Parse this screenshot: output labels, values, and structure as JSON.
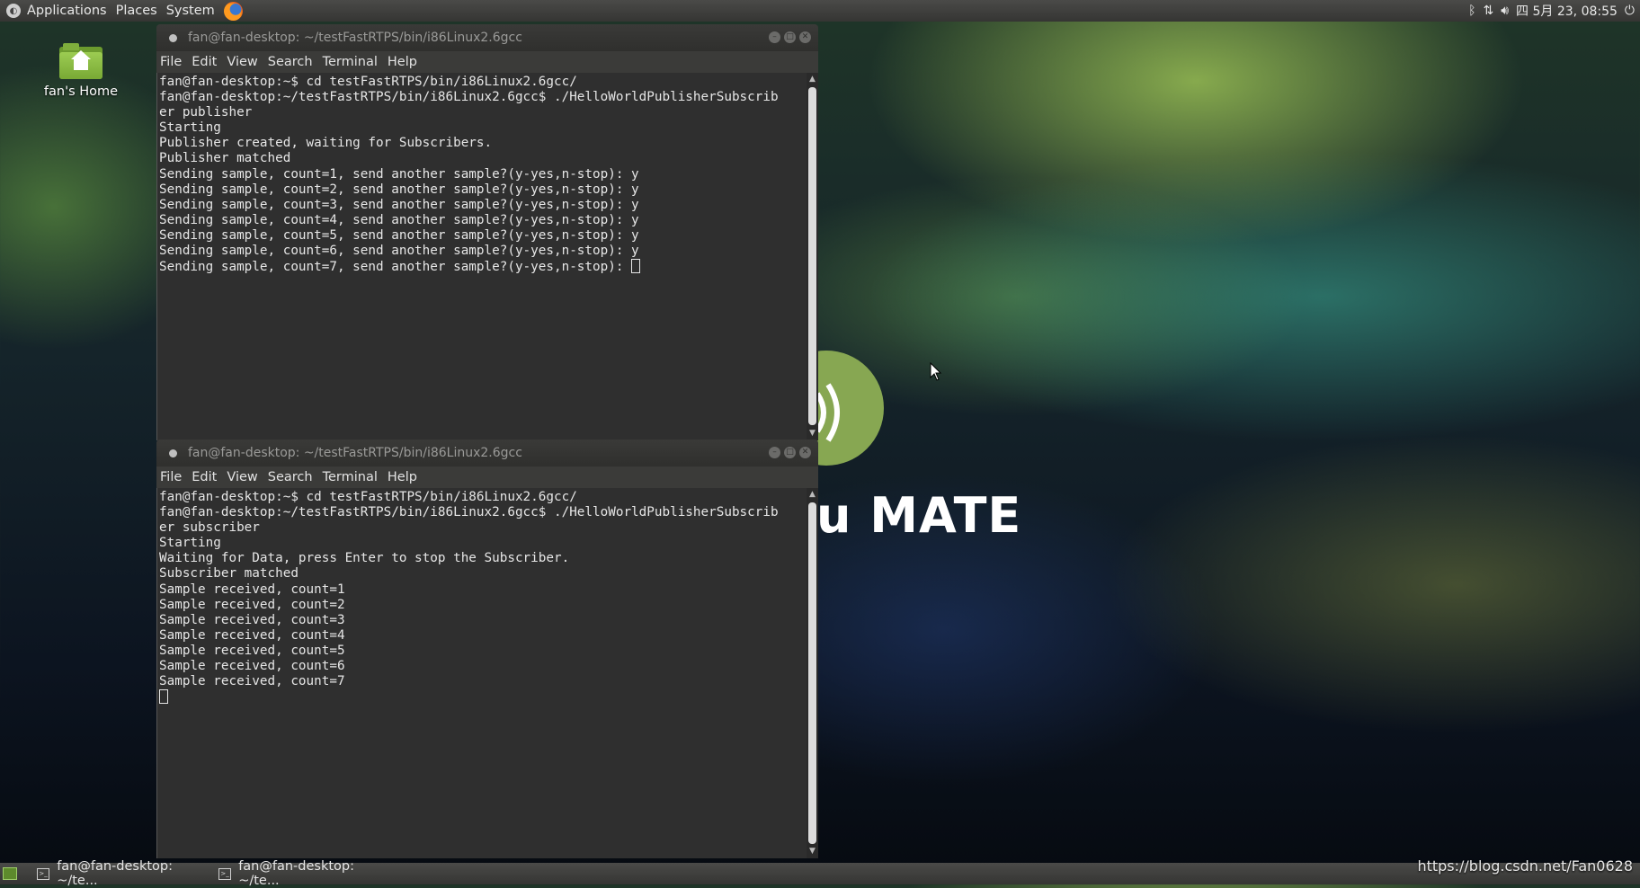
{
  "top_panel": {
    "menus": [
      "Applications",
      "Places",
      "System"
    ],
    "datetime": "四 5月 23, 08:55"
  },
  "desktop": {
    "home_label": "fan's Home",
    "wallpaper_text": "u MATE"
  },
  "terminal_menu": [
    "File",
    "Edit",
    "View",
    "Search",
    "Terminal",
    "Help"
  ],
  "windows": [
    {
      "title": "fan@fan-desktop: ~/testFastRTPS/bin/i86Linux2.6gcc",
      "lines": [
        "fan@fan-desktop:~$ cd testFastRTPS/bin/i86Linux2.6gcc/",
        "fan@fan-desktop:~/testFastRTPS/bin/i86Linux2.6gcc$ ./HelloWorldPublisherSubscrib",
        "er publisher",
        "Starting",
        "Publisher created, waiting for Subscribers.",
        "Publisher matched",
        "Sending sample, count=1, send another sample?(y-yes,n-stop): y",
        "Sending sample, count=2, send another sample?(y-yes,n-stop): y",
        "Sending sample, count=3, send another sample?(y-yes,n-stop): y",
        "Sending sample, count=4, send another sample?(y-yes,n-stop): y",
        "Sending sample, count=5, send another sample?(y-yes,n-stop): y",
        "Sending sample, count=6, send another sample?(y-yes,n-stop): y",
        "Sending sample, count=7, send another sample?(y-yes,n-stop): "
      ]
    },
    {
      "title": "fan@fan-desktop: ~/testFastRTPS/bin/i86Linux2.6gcc",
      "lines": [
        "fan@fan-desktop:~$ cd testFastRTPS/bin/i86Linux2.6gcc/",
        "fan@fan-desktop:~/testFastRTPS/bin/i86Linux2.6gcc$ ./HelloWorldPublisherSubscrib",
        "er subscriber",
        "Starting",
        "Waiting for Data, press Enter to stop the Subscriber.",
        "Subscriber matched",
        "Sample received, count=1",
        "Sample received, count=2",
        "Sample received, count=3",
        "Sample received, count=4",
        "Sample received, count=5",
        "Sample received, count=6",
        "Sample received, count=7",
        ""
      ]
    }
  ],
  "taskbar": {
    "tasks": [
      "fan@fan-desktop: ~/te...",
      "fan@fan-desktop: ~/te..."
    ]
  },
  "watermark": "https://blog.csdn.net/Fan0628",
  "colors": {
    "terminal_bg": "#2f2f2f",
    "panel_bg": "#3d3d3b",
    "mate_green": "#87a752"
  }
}
